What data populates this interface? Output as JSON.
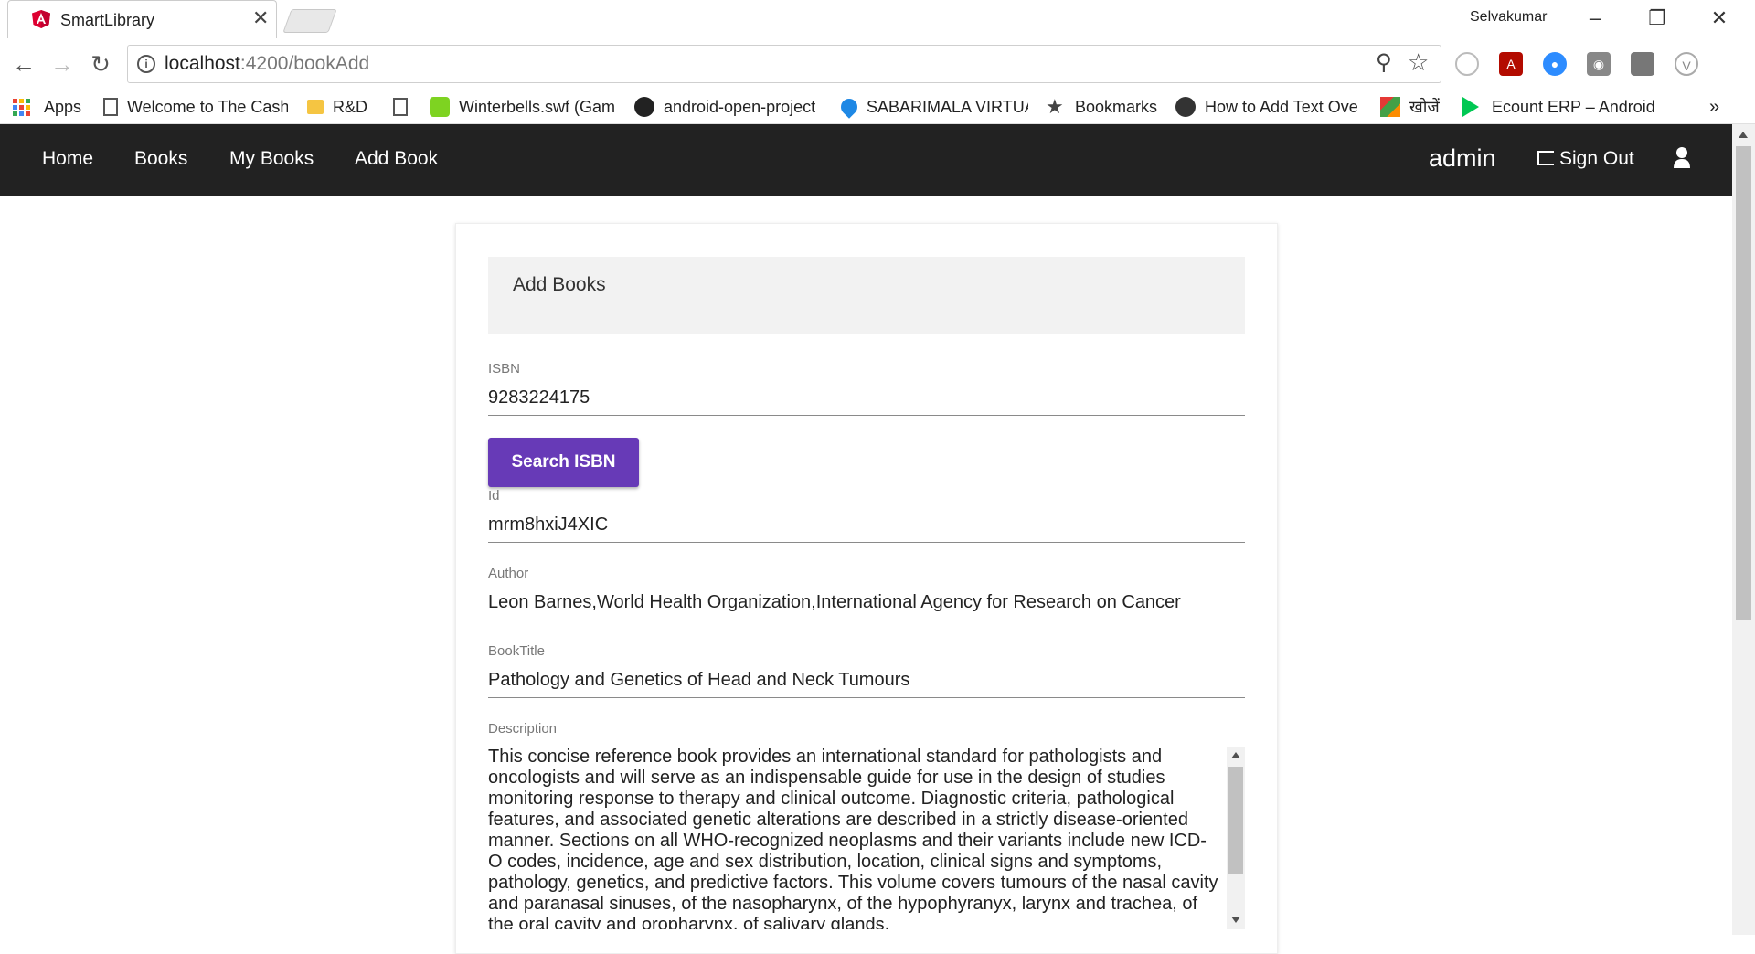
{
  "browser": {
    "tab_title": "SmartLibrary",
    "tab_close": "✕",
    "profile_name": "Selvakumar",
    "url_host": "localhost",
    "url_path": ":4200/bookAdd",
    "bookmarks": [
      {
        "label": "Apps"
      },
      {
        "label": "Welcome to The Cash"
      },
      {
        "label": "R&D"
      },
      {
        "label": ""
      },
      {
        "label": "Winterbells.swf (Gam"
      },
      {
        "label": "android-open-project"
      },
      {
        "label": "SABARIMALA VIRTUA"
      },
      {
        "label": "Bookmarks"
      },
      {
        "label": "How to Add Text Ove"
      },
      {
        "label": "खोजें"
      },
      {
        "label": "Ecount ERP – Android"
      }
    ],
    "overflow": "»"
  },
  "appnav": {
    "links": [
      "Home",
      "Books",
      "My Books",
      "Add Book"
    ],
    "user": "admin",
    "signout": "Sign Out"
  },
  "form": {
    "title": "Add Books",
    "isbn_label": "ISBN",
    "isbn_value": "9283224175",
    "search_button": "Search ISBN",
    "id_label": "Id",
    "id_value": "mrm8hxiJ4XIC",
    "author_label": "Author",
    "author_value": "Leon Barnes,World Health Organization,International Agency for Research on Cancer",
    "title_label": "BookTitle",
    "title_value": "Pathology and Genetics of Head and Neck Tumours",
    "description_label": "Description",
    "description_value": "This concise reference book provides an international standard for pathologists and oncologists and will serve as an indispensable guide for use in the design of studies monitoring response to therapy and clinical outcome. Diagnostic criteria, pathological features, and associated genetic alterations are described in a strictly disease-oriented manner. Sections on all WHO-recognized neoplasms and their variants include new ICD-O codes, incidence, age and sex distribution, location, clinical signs and symptoms, pathology, genetics, and predictive factors. This volume covers tumours of the nasal cavity and paranasal sinuses, of the nasopharynx, of the hypophyranyx, larynx and trachea, of the oral cavity and oropharynx, of salivary glands,"
  },
  "colors": {
    "navbar": "#222222",
    "button": "#673ab7"
  }
}
